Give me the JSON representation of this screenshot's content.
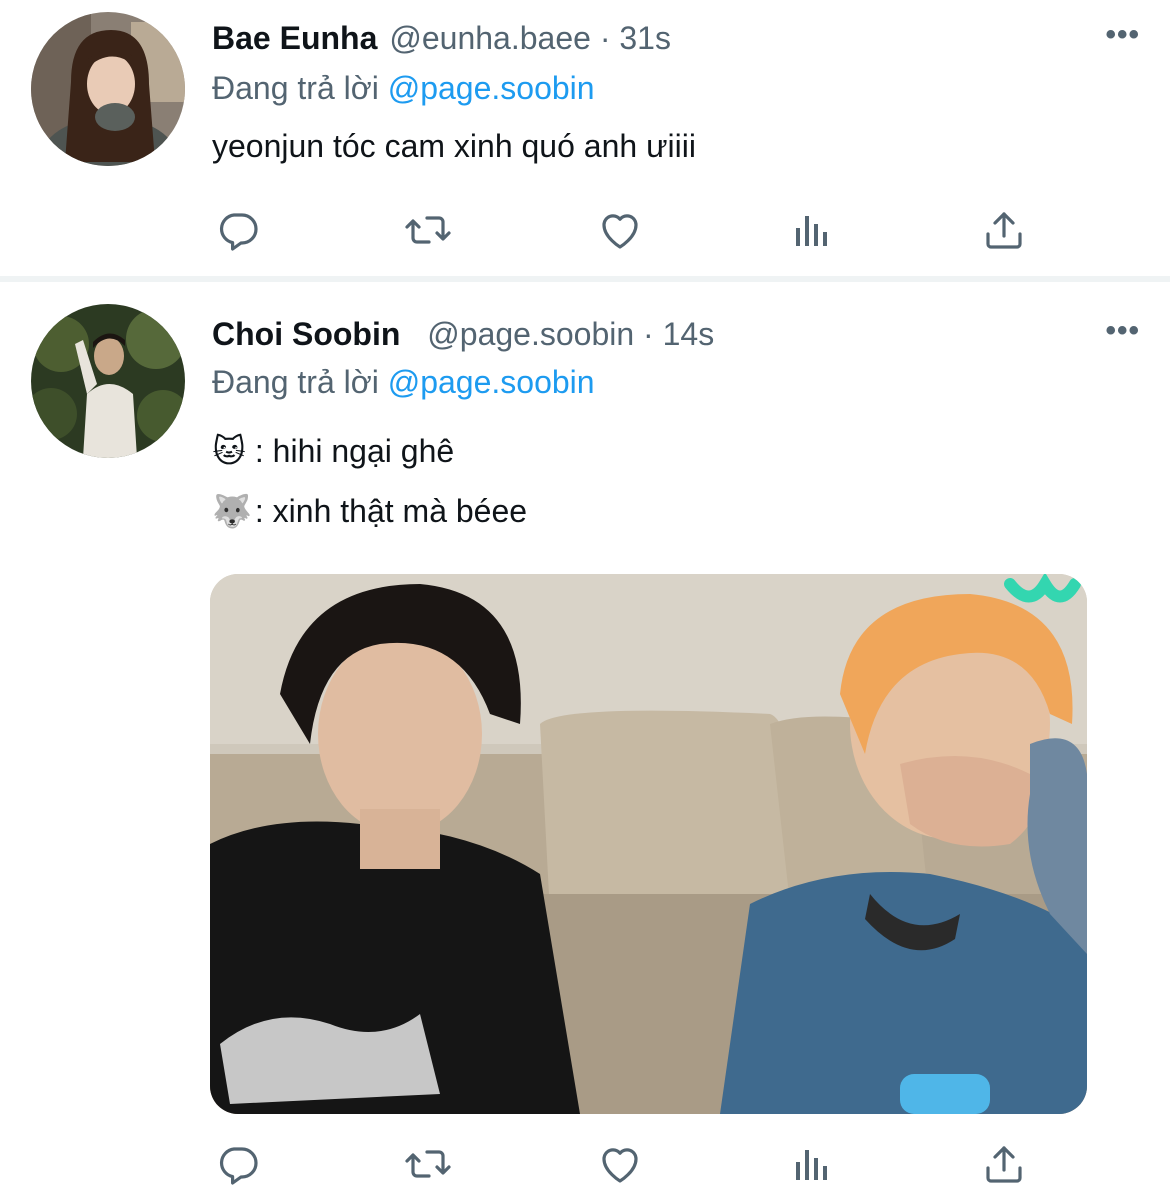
{
  "tweets": [
    {
      "author_name": "Bae Eunha",
      "handle": "@eunha.baee",
      "separator": "·",
      "time": "31s",
      "reply_prefix": "Đang trả lời",
      "reply_to": "@page.soobin",
      "text": "yeonjun tóc cam xinh quó anh ưiiii"
    },
    {
      "author_name": "Choi Soobin",
      "handle": "@page.soobin",
      "separator": "·",
      "time": "14s",
      "reply_prefix": "Đang trả lời",
      "reply_to": "@page.soobin",
      "lines": [
        {
          "emoji": "🐱",
          "text": ": hihi ngại ghê"
        },
        {
          "emoji": "🐺",
          "text": ": xinh thật mà béee"
        }
      ]
    }
  ],
  "more_label": "•••",
  "action_icons": [
    "reply-icon",
    "retweet-icon",
    "like-icon",
    "analytics-icon",
    "share-icon"
  ],
  "colors": {
    "text": "#0f1419",
    "secondary": "#536471",
    "mention": "#1d9bf0",
    "divider": "#eff3f4",
    "icon": "#536471"
  }
}
